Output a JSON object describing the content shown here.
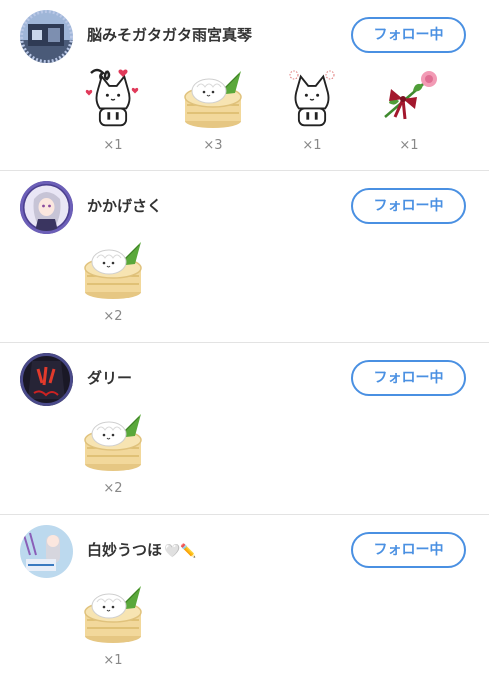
{
  "followers": [
    {
      "name": "脳みそガタガタ雨宮真琴",
      "follow_label": "フォロー中",
      "gifts": [
        {
          "icon": "suki-cat-sticker-icon",
          "count": "×1"
        },
        {
          "icon": "steamed-bun-icon",
          "count": "×3"
        },
        {
          "icon": "cat-sticker-icon",
          "count": "×1"
        },
        {
          "icon": "rose-ribbon-icon",
          "count": "×1"
        }
      ]
    },
    {
      "name": "かかげさく",
      "follow_label": "フォロー中",
      "gifts": [
        {
          "icon": "steamed-bun-icon",
          "count": "×2"
        }
      ]
    },
    {
      "name": "ダリー",
      "follow_label": "フォロー中",
      "gifts": [
        {
          "icon": "steamed-bun-icon",
          "count": "×2"
        }
      ]
    },
    {
      "name": "白妙うつほ",
      "name_deco": "🤍✏️",
      "follow_label": "フォロー中",
      "gifts": [
        {
          "icon": "steamed-bun-icon",
          "count": "×1"
        }
      ]
    }
  ],
  "colors": {
    "accent": "#4a90e2",
    "divider": "#e3e3e3",
    "count_text": "#888888"
  }
}
